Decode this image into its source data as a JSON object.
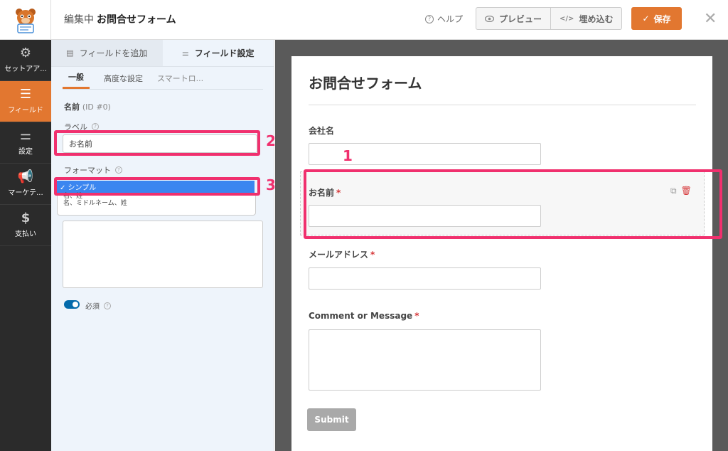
{
  "header": {
    "editing_prefix": "編集中",
    "form_name": "お問合せフォーム",
    "help_label": "ヘルプ",
    "preview_label": "プレビュー",
    "embed_label": "埋め込む",
    "save_label": "保存",
    "accent": "#e27730"
  },
  "rail": {
    "items": [
      {
        "label": "セットアア...",
        "icon": "gear-icon"
      },
      {
        "label": "フィールド",
        "icon": "fields-list-icon",
        "active": true
      },
      {
        "label": "設定",
        "icon": "sliders-icon"
      },
      {
        "label": "マーケテ...",
        "icon": "megaphone-icon"
      },
      {
        "label": "支払い",
        "icon": "dollar-icon"
      }
    ]
  },
  "panel": {
    "tab_add": "フィールドを追加",
    "tab_options": "フィールド設定",
    "subtab_general": "一般",
    "subtab_advanced": "高度な設定",
    "subtab_smart": "スマートロ...",
    "field_name": "名前",
    "field_id": "(ID #0)",
    "label_caption": "ラベル",
    "label_value": "お名前",
    "format_caption": "フォーマット",
    "format_selected": "✓ シンプル",
    "format_options": [
      "名、姓",
      "名、ミドルネーム、姓"
    ],
    "required_label": "必須"
  },
  "annotations": [
    "1",
    "2",
    "3"
  ],
  "preview": {
    "form_title": "お問合せフォーム",
    "fields": [
      {
        "label": "会社名",
        "required": false
      },
      {
        "label": "お名前",
        "required": true
      },
      {
        "label": "メールアドレス",
        "required": true
      },
      {
        "label": "Comment or Message",
        "required": true
      }
    ],
    "required_mark": "*",
    "submit_label": "Submit"
  }
}
